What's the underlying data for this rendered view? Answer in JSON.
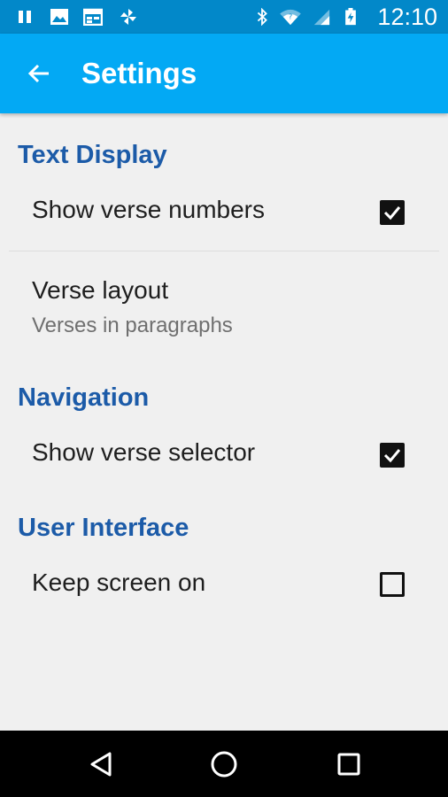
{
  "status_bar": {
    "time": "12:10",
    "icons": [
      "pause-icon",
      "image-icon",
      "calendar-icon",
      "pinwheel-icon",
      "bluetooth-icon",
      "wifi-icon",
      "signal-icon",
      "battery-charging-icon"
    ]
  },
  "app_bar": {
    "back_icon": "arrow-back-icon",
    "title": "Settings"
  },
  "sections": {
    "text_display": {
      "header": "Text Display",
      "show_verse_numbers": {
        "label": "Show verse numbers",
        "checked": true
      },
      "verse_layout": {
        "label": "Verse layout",
        "summary": "Verses in paragraphs"
      }
    },
    "navigation": {
      "header": "Navigation",
      "show_verse_selector": {
        "label": "Show verse selector",
        "checked": true
      }
    },
    "user_interface": {
      "header": "User Interface",
      "keep_screen_on": {
        "label": "Keep screen on",
        "checked": false
      }
    }
  },
  "nav_bar": {
    "icons": [
      "back-triangle-icon",
      "home-circle-icon",
      "recents-square-icon"
    ]
  },
  "colors": {
    "status_bar": "#0288c9",
    "app_bar": "#03a9f4",
    "section_header": "#1c5ba8",
    "background": "#f0f0f0"
  }
}
